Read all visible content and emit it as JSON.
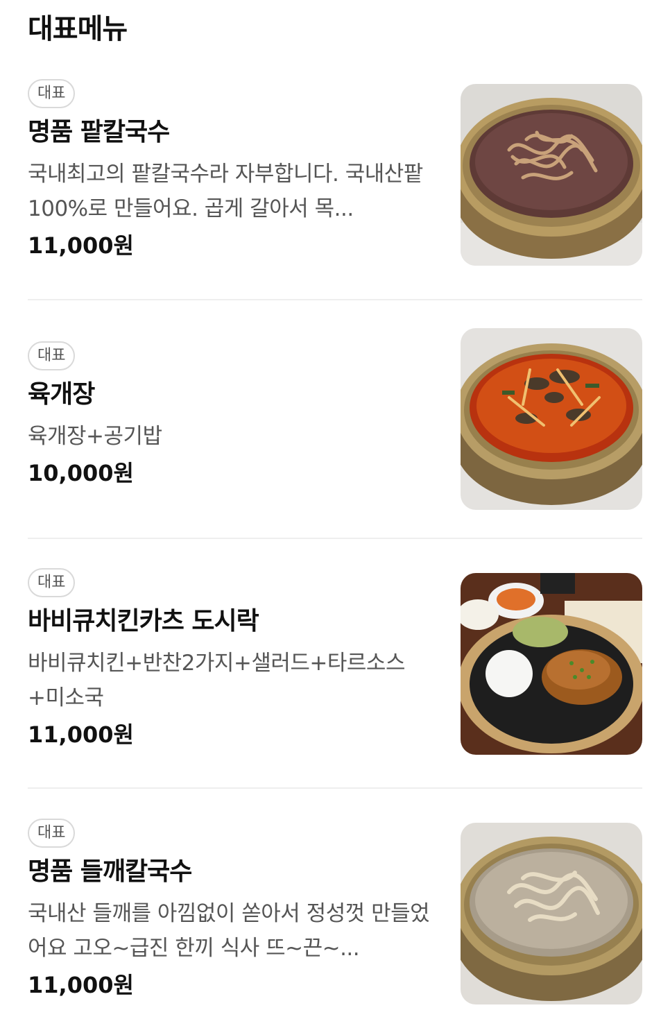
{
  "section": {
    "title": "대표메뉴"
  },
  "items": [
    {
      "badge": "대표",
      "name": "명품 팥칼국수",
      "description": "국내최고의 팥칼국수라 자부합니다. 국내산팥100%로 만들어요. 곱게 갈아서 목...",
      "price": "11,000원",
      "image_icon": "red-bean-noodle-photo"
    },
    {
      "badge": "대표",
      "name": "육개장",
      "description": "육개장+공기밥",
      "price": "10,000원",
      "image_icon": "spicy-beef-soup-photo"
    },
    {
      "badge": "대표",
      "name": "바비큐치킨카츠 도시락",
      "description": "바비큐치킨+반찬2가지+샐러드+타르소스+미소국",
      "price": "11,000원",
      "image_icon": "chicken-katsu-lunchbox-photo"
    },
    {
      "badge": "대표",
      "name": "명품 들깨칼국수",
      "description": "국내산 들깨를 아낌없이 쏟아서 정성껏 만들었어요 고오~급진 한끼 식사 뜨~끈~...",
      "price": "11,000원",
      "image_icon": "perilla-noodle-photo"
    }
  ]
}
